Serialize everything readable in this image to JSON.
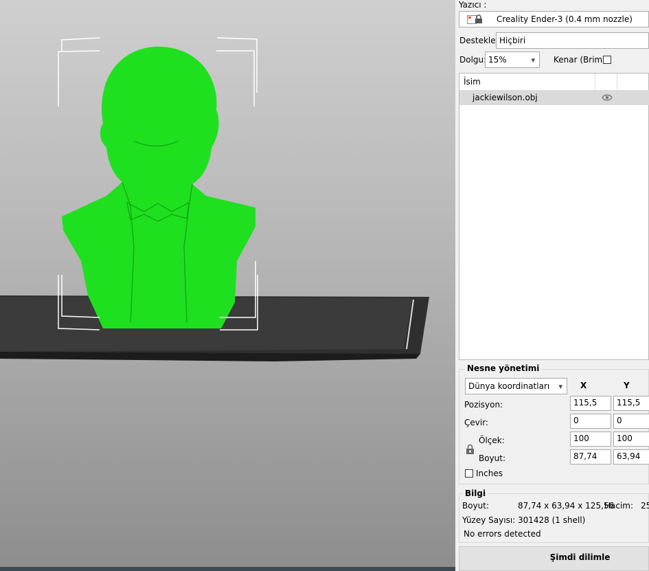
{
  "printer": {
    "label": "Yazıcı :",
    "name": "Creality Ender-3 (0.4 mm nozzle)"
  },
  "supports": {
    "label": "Destekler:",
    "value": "Hiçbiri"
  },
  "infill": {
    "label": "Dolgu:",
    "value": "15%"
  },
  "brim": {
    "label": "Kenar (Brim):",
    "checked": false
  },
  "object_list": {
    "header_name": "İsim",
    "items": [
      {
        "name": "jackiewilson.obj",
        "visible": true
      }
    ]
  },
  "object_management": {
    "title": "Nesne yönetimi",
    "coordinate_system": "Dünya koordinatları",
    "col_x": "X",
    "col_y": "Y",
    "position": {
      "label": "Pozisyon:",
      "x": "115,5",
      "y": "115,5"
    },
    "rotate": {
      "label": "Çevir:",
      "x": "0",
      "y": "0"
    },
    "scale": {
      "label": "Ölçek:",
      "x": "100",
      "y": "100"
    },
    "size": {
      "label": "Boyut:",
      "x": "87,74",
      "y": "63,94"
    },
    "inches": {
      "label": "Inches",
      "checked": false
    }
  },
  "info": {
    "title": "Bilgi",
    "size_label": "Boyut:",
    "size_value": "87,74 x 63,94 x 125,56",
    "volume_label": "Hacim:",
    "volume_value": "25",
    "faces_label": "Yüzey Sayısı:",
    "faces_value": "301428 (1 shell)",
    "errors": "No errors detected"
  },
  "slice_button": "Şimdi dilimle",
  "colors": {
    "model": "#1fe01f",
    "bed": "#2f2f2f",
    "panel": "#f0f0f0"
  }
}
